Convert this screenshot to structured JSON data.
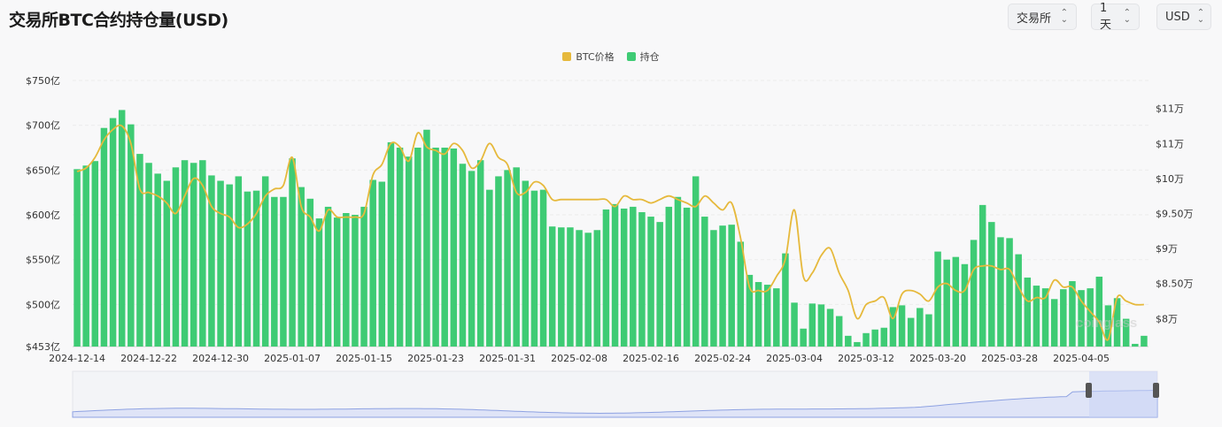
{
  "header": {
    "title": "交易所BTC合约持仓量(USD)",
    "exchange_label": "交易所",
    "interval_label": "1天",
    "currency_label": "USD"
  },
  "legend": [
    {
      "label": "BTC价格",
      "color": "#e6b93c"
    },
    {
      "label": "持仓",
      "color": "#3ecb74"
    }
  ],
  "watermark": "coinglass",
  "chart_data": {
    "type": "bar",
    "title": "交易所BTC合约持仓量(USD)",
    "grid": true,
    "legend_position": "top-center",
    "x_tick_labels": [
      "2024-12-14",
      "2024-12-22",
      "2024-12-30",
      "2025-01-07",
      "2025-01-15",
      "2025-01-23",
      "2025-01-31",
      "2025-02-08",
      "2025-02-16",
      "2025-02-24",
      "2025-03-04",
      "2025-03-12",
      "2025-03-20",
      "2025-03-28",
      "2025-04-05"
    ],
    "y_left": {
      "ticks": [
        453,
        500,
        550,
        600,
        650,
        700,
        750
      ],
      "tick_labels": [
        "$453亿",
        "$500亿",
        "$550亿",
        "$600亿",
        "$650亿",
        "$700亿",
        "$750亿"
      ],
      "range": [
        453,
        750
      ]
    },
    "y_right": {
      "ticks": [
        80000,
        85000,
        90000,
        95000,
        100000,
        105000,
        110000
      ],
      "tick_labels": [
        "$8万",
        "$8.50万",
        "$9万",
        "$9.50万",
        "$10万",
        "$11万",
        "$11万"
      ],
      "range": [
        76000,
        114000
      ]
    },
    "series": [
      {
        "name": "持仓",
        "axis": "left",
        "color": "#3ecb74",
        "values": [
          651,
          655,
          660,
          697,
          708,
          717,
          701,
          668,
          658,
          646,
          638,
          653,
          661,
          658,
          661,
          644,
          638,
          634,
          643,
          626,
          627,
          643,
          620,
          620,
          663,
          631,
          618,
          596,
          609,
          597,
          602,
          600,
          609,
          639,
          637,
          681,
          675,
          665,
          675,
          695,
          675,
          675,
          674,
          657,
          649,
          661,
          628,
          643,
          650,
          653,
          638,
          627,
          628,
          587,
          586,
          586,
          583,
          580,
          583,
          606,
          612,
          607,
          609,
          603,
          598,
          592,
          609,
          620,
          608,
          643,
          598,
          583,
          588,
          589,
          570,
          533,
          525,
          522,
          518,
          557,
          502,
          473,
          501,
          500,
          495,
          487,
          465,
          458,
          468,
          472,
          474,
          497,
          499,
          485,
          496,
          489,
          559,
          550,
          553,
          545,
          572,
          611,
          592,
          575,
          574,
          556,
          530,
          521,
          518,
          506,
          517,
          526,
          516,
          518,
          531,
          499,
          507,
          484,
          456,
          465
        ]
      },
      {
        "name": "BTC价格",
        "axis": "right",
        "color": "#e6b93c",
        "values": [
          101000,
          101500,
          103000,
          105500,
          107000,
          107500,
          105000,
          98500,
          98000,
          97500,
          96500,
          95000,
          97500,
          100000,
          99000,
          96000,
          95000,
          94500,
          93000,
          93500,
          95000,
          97500,
          98500,
          99000,
          103000,
          96000,
          94500,
          92500,
          95500,
          94500,
          94500,
          94500,
          95000,
          100500,
          102000,
          105000,
          104500,
          102500,
          106500,
          104500,
          104000,
          103500,
          105000,
          104000,
          101500,
          102500,
          105000,
          103000,
          102000,
          98000,
          98000,
          99500,
          99000,
          97000,
          97000,
          97000,
          97000,
          97000,
          97000,
          97000,
          96000,
          97500,
          97000,
          97000,
          96500,
          97000,
          97500,
          97000,
          96500,
          96000,
          97500,
          96500,
          95500,
          96500,
          91500,
          84500,
          84000,
          84000,
          86000,
          88500,
          95500,
          86000,
          86500,
          89000,
          90000,
          86500,
          84000,
          80000,
          82000,
          82500,
          83000,
          80000,
          83500,
          84000,
          83500,
          82500,
          84500,
          85000,
          84000,
          84000,
          87000,
          87500,
          87500,
          87000,
          87000,
          84500,
          82500,
          83000,
          83000,
          85500,
          84500,
          84500,
          82500,
          81000,
          79500,
          77000,
          83000,
          82500,
          82000,
          82000
        ],
        "interpolation": "smooth"
      }
    ]
  }
}
